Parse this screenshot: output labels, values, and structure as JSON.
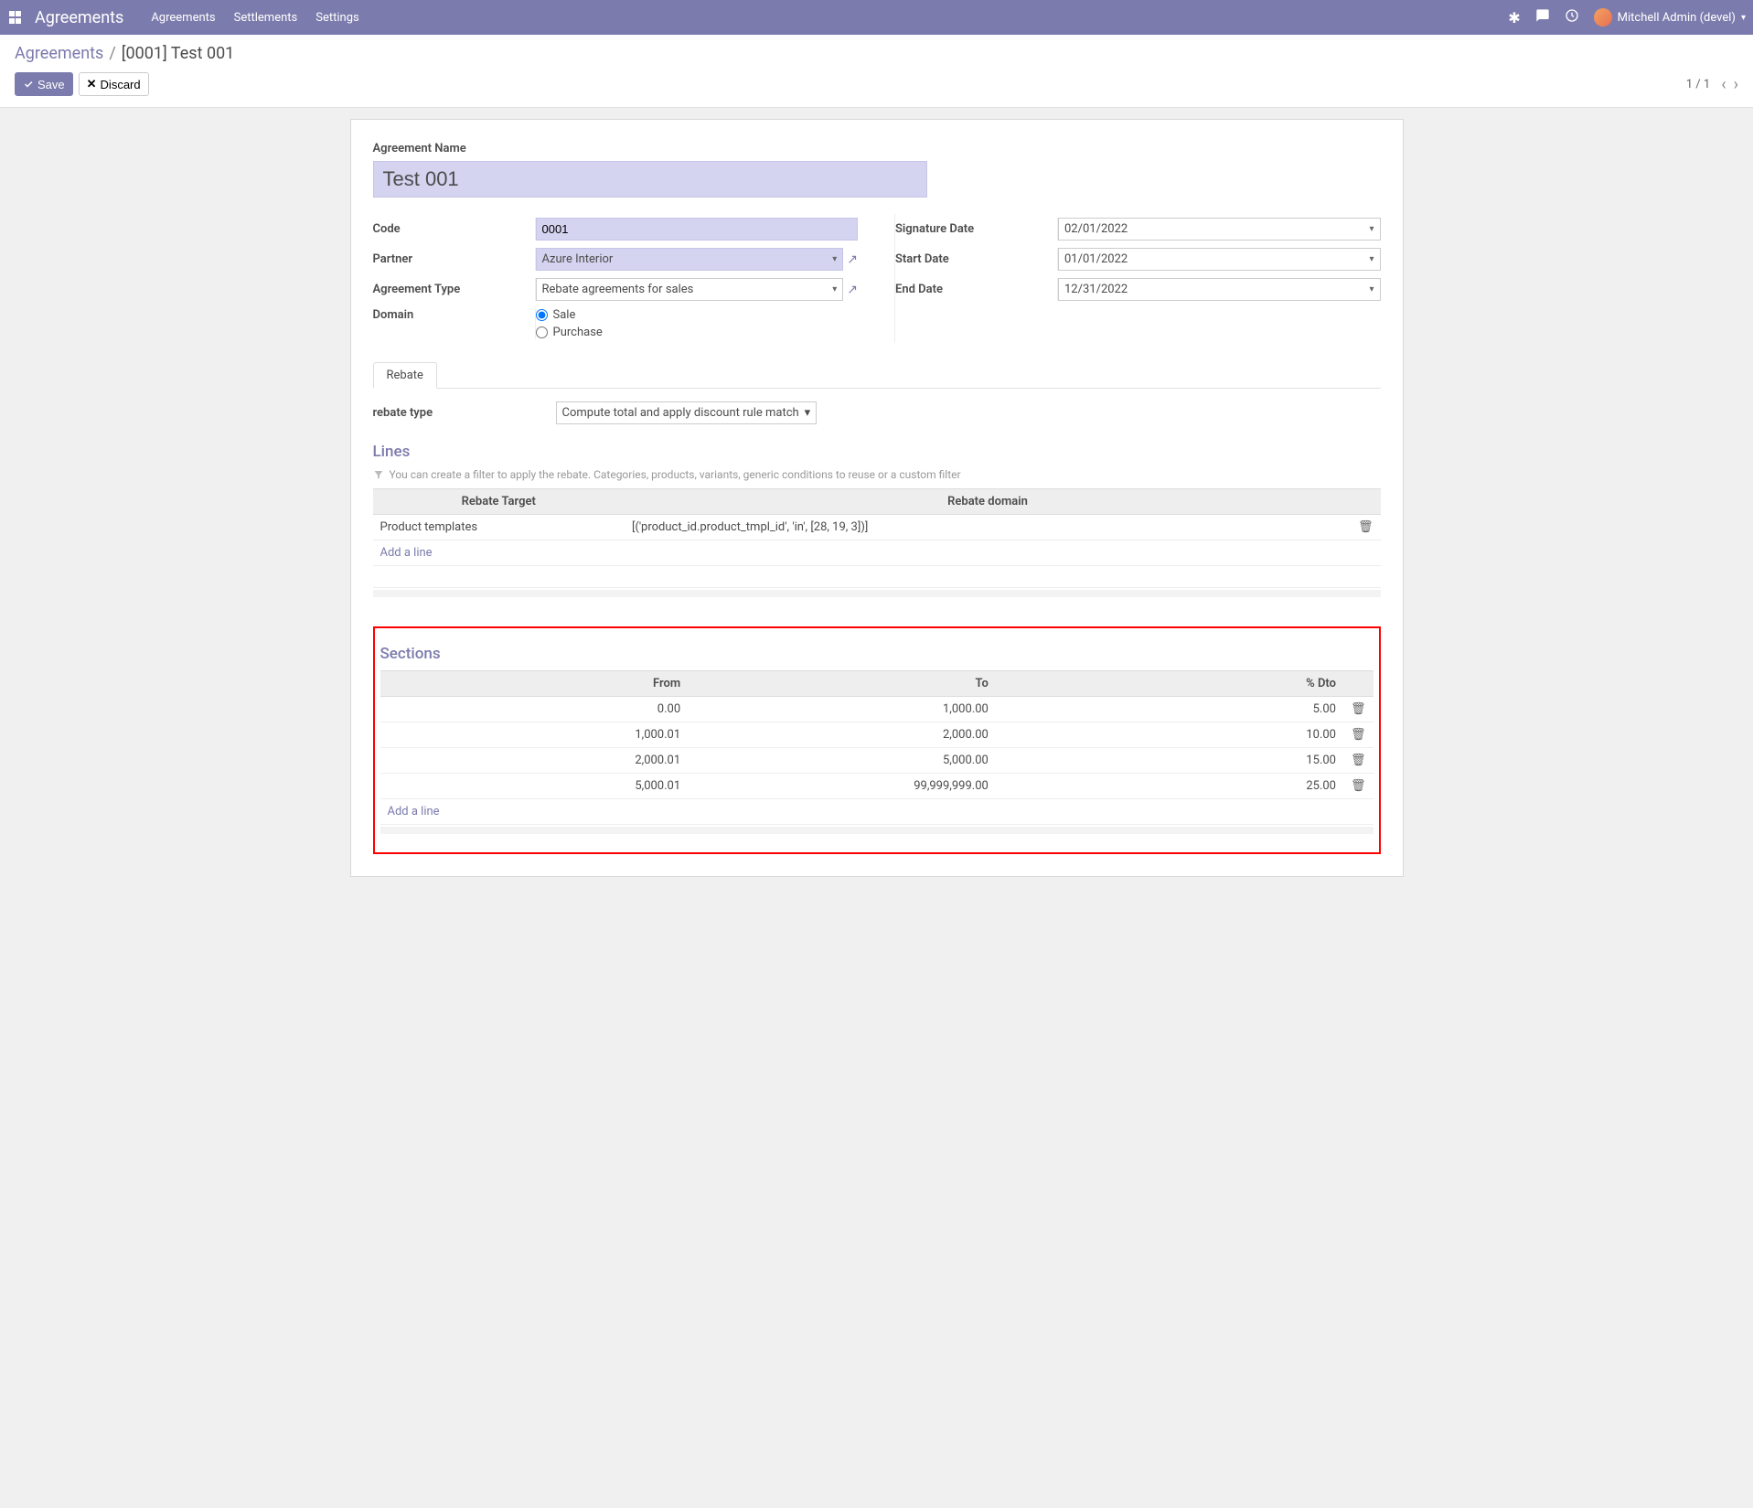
{
  "navbar": {
    "brand": "Agreements",
    "menu": [
      "Agreements",
      "Settlements",
      "Settings"
    ],
    "user": "Mitchell Admin (devel)"
  },
  "breadcrumb": {
    "link": "Agreements",
    "sep": "/",
    "current": "[0001] Test 001"
  },
  "buttons": {
    "save": "Save",
    "discard": "Discard"
  },
  "pager": {
    "text": "1 / 1"
  },
  "form": {
    "name_label": "Agreement Name",
    "name_value": "Test 001",
    "code_label": "Code",
    "code_value": "0001",
    "partner_label": "Partner",
    "partner_value": "Azure Interior",
    "type_label": "Agreement Type",
    "type_value": "Rebate agreements for sales",
    "domain_label": "Domain",
    "radio_sale": "Sale",
    "radio_purchase": "Purchase",
    "signature_label": "Signature Date",
    "signature_value": "02/01/2022",
    "start_label": "Start Date",
    "start_value": "01/01/2022",
    "end_label": "End Date",
    "end_value": "12/31/2022"
  },
  "tabs": {
    "rebate": "Rebate"
  },
  "rebate": {
    "type_label": "rebate type",
    "type_value": "Compute total and apply discount rule match",
    "lines_title": "Lines",
    "hint": "You can create a filter to apply the rebate. Categories, products, variants, generic conditions to reuse or a custom filter",
    "lines_headers": {
      "target": "Rebate Target",
      "domain": "Rebate domain"
    },
    "lines": [
      {
        "target": "Product templates",
        "domain": "[('product_id.product_tmpl_id', 'in', [28, 19, 3])]"
      }
    ],
    "add_line": "Add a line"
  },
  "sections": {
    "title": "Sections",
    "headers": {
      "from": "From",
      "to": "To",
      "dto": "% Dto"
    },
    "rows": [
      {
        "from": "0.00",
        "to": "1,000.00",
        "dto": "5.00"
      },
      {
        "from": "1,000.01",
        "to": "2,000.00",
        "dto": "10.00"
      },
      {
        "from": "2,000.01",
        "to": "5,000.00",
        "dto": "15.00"
      },
      {
        "from": "5,000.01",
        "to": "99,999,999.00",
        "dto": "25.00"
      }
    ],
    "add_line": "Add a line"
  }
}
